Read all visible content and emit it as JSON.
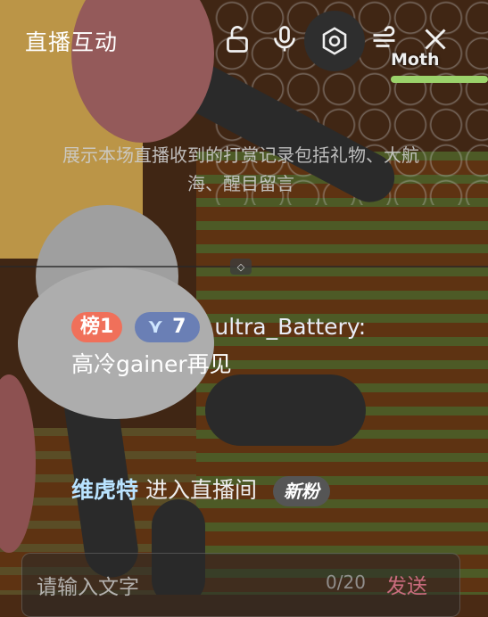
{
  "header": {
    "title": "直播互动",
    "icons": [
      "lock-icon",
      "mic-icon",
      "settings-icon",
      "wind-icon",
      "close-icon"
    ]
  },
  "background": {
    "player_name": "Moth"
  },
  "hint": {
    "text": "展示本场直播收到的打赏记录包括礼物、大航海、醒目留言"
  },
  "messages": {
    "danmaku": {
      "rank_badge": "榜1",
      "guard_level": "7",
      "username": "ultra_Battery:",
      "content": "高冷gainer再见"
    },
    "enter": {
      "username": "维虎特",
      "action": "进入直播间",
      "badge": "新粉"
    }
  },
  "input": {
    "placeholder": "请输入文字",
    "counter": "0/20",
    "send_label": "发送"
  },
  "colors": {
    "rank_badge": "#f0705a",
    "guard_badge": "#6a7fb5",
    "send": "#c96c7e"
  }
}
